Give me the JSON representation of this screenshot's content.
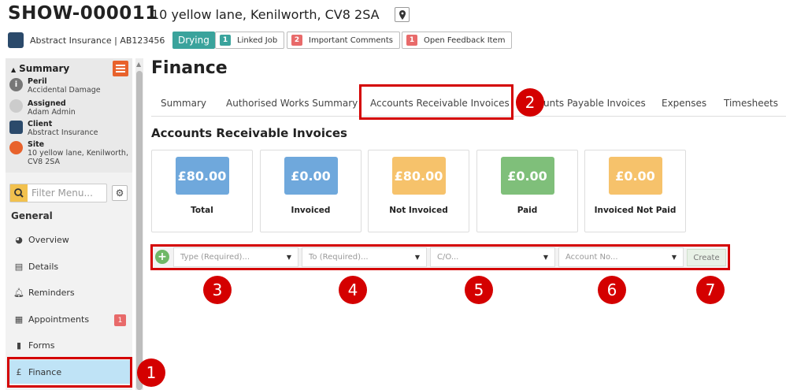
{
  "header": {
    "job_id": "SHOW-000011",
    "address": "10 yellow lane, Kenilworth, CV8 2SA",
    "client_line": "Abstract Insurance | AB123456",
    "status": "Drying",
    "tags": [
      {
        "count": "1",
        "label": "Linked Job",
        "color": "#3aa39c"
      },
      {
        "count": "2",
        "label": "Important Comments",
        "color": "#e86a6a"
      },
      {
        "count": "1",
        "label": "Open Feedback Item",
        "color": "#e86a6a"
      }
    ]
  },
  "sidebar": {
    "summary_title": "Summary",
    "summary": [
      {
        "label": "Peril",
        "value": "Accidental Damage"
      },
      {
        "label": "Assigned",
        "value": "Adam Admin"
      },
      {
        "label": "Client",
        "value": "Abstract Insurance"
      },
      {
        "label": "Site",
        "value": "10 yellow lane, Kenilworth,",
        "value2": "CV8 2SA"
      }
    ],
    "filter_placeholder": "Filter Menu...",
    "section": "General",
    "nav": [
      {
        "label": "Overview",
        "icon": "dashboard-icon"
      },
      {
        "label": "Details",
        "icon": "clipboard-icon"
      },
      {
        "label": "Reminders",
        "icon": "bell-icon"
      },
      {
        "label": "Appointments",
        "icon": "calendar-icon",
        "badge": "1"
      },
      {
        "label": "Forms",
        "icon": "document-icon"
      },
      {
        "label": "Finance",
        "icon": "pound-icon",
        "active": true
      }
    ]
  },
  "main": {
    "title": "Finance",
    "tabs": [
      "Summary",
      "Authorised Works Summary",
      "Accounts Receivable Invoices",
      "unts Payable Invoices",
      "Expenses",
      "Timesheets"
    ],
    "active_tab": "Accounts Receivable Invoices",
    "section_title": "Accounts Receivable Invoices",
    "cards": [
      {
        "value": "£80.00",
        "label": "Total",
        "color": "#6fa8dc"
      },
      {
        "value": "£0.00",
        "label": "Invoiced",
        "color": "#6fa8dc"
      },
      {
        "value": "£80.00",
        "label": "Not Invoiced",
        "color": "#f6c26b"
      },
      {
        "value": "£0.00",
        "label": "Paid",
        "color": "#7fbf7a"
      },
      {
        "value": "£0.00",
        "label": "Invoiced Not Paid",
        "color": "#f6c26b"
      }
    ],
    "form": {
      "type_placeholder": "Type (Required)...",
      "to_placeholder": "To (Required)...",
      "co_placeholder": "C/O...",
      "account_placeholder": "Account No...",
      "create_label": "Create"
    }
  },
  "callouts": [
    "1",
    "2",
    "3",
    "4",
    "5",
    "6",
    "7"
  ]
}
